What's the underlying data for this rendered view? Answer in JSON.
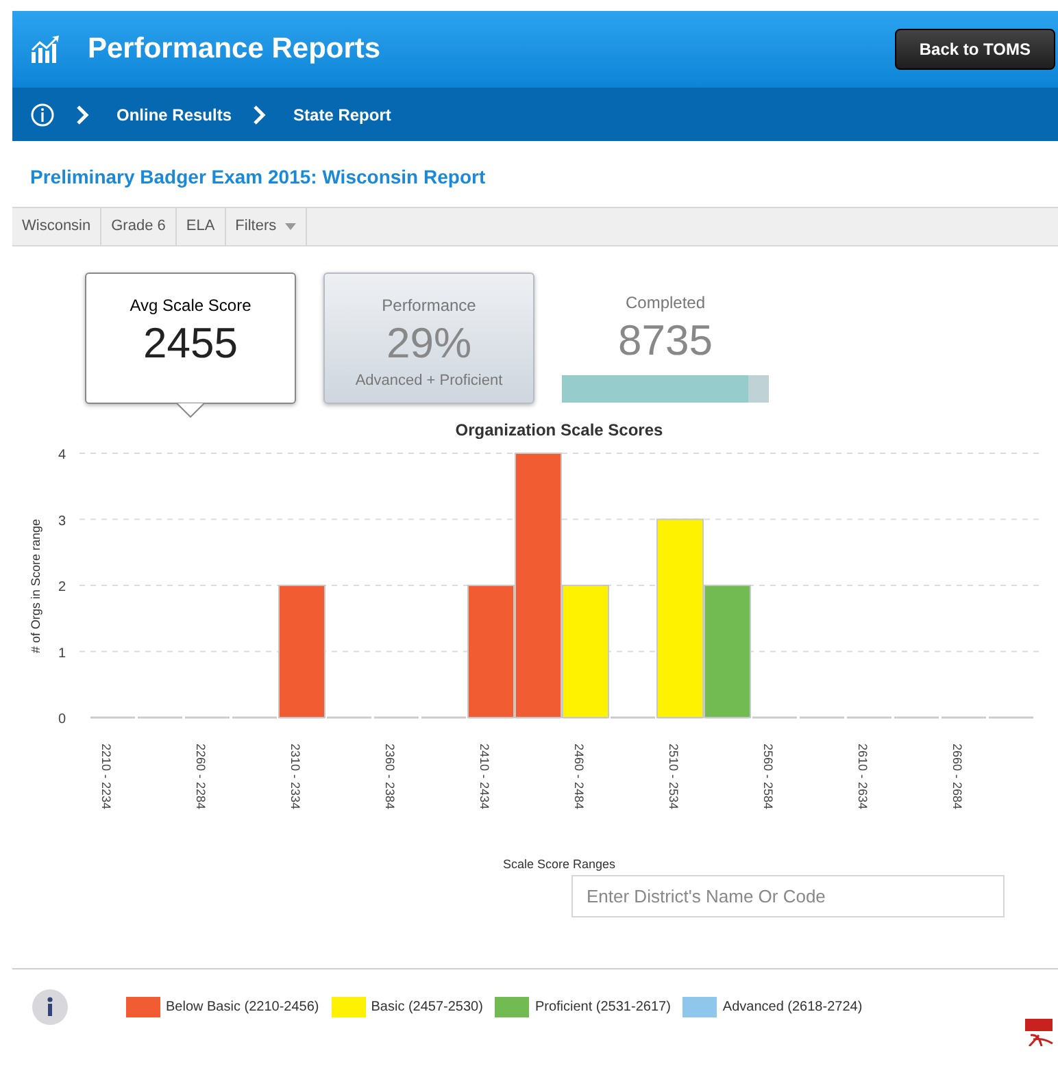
{
  "header": {
    "title": "Performance Reports",
    "back_button": "Back to TOMS"
  },
  "breadcrumbs": [
    "Online Results",
    "State Report"
  ],
  "report_title": "Preliminary Badger Exam 2015: Wisconsin Report",
  "filters": [
    {
      "label": "Wisconsin",
      "kind": "tag"
    },
    {
      "label": "Grade 6",
      "kind": "tag"
    },
    {
      "label": "ELA",
      "kind": "tag"
    },
    {
      "label": "Filters",
      "kind": "dropdown"
    }
  ],
  "cards": [
    {
      "kind": "stat",
      "selected": true,
      "label": "Avg Scale Score",
      "value": "2455"
    },
    {
      "kind": "stat",
      "selected": false,
      "label": "Performance",
      "value": "29%",
      "sublabel": "Advanced + Proficient"
    },
    {
      "kind": "progress",
      "label": "Completed",
      "value": "8735",
      "level": 0.9
    }
  ],
  "chart": {
    "chart_data": {
      "type": "bar",
      "title": "Organization Scale Scores",
      "xlabel": "Scale Score Ranges",
      "ylabel": "# of Orgs in Score range",
      "stacked": true,
      "grid": true,
      "categories": [
        "2210 - 2234",
        null,
        "2260 - 2284",
        null,
        "2310 - 2334",
        null,
        "2360 - 2384",
        null,
        "2410 - 2434",
        null,
        "2460 - 2484",
        null,
        "2510 - 2534",
        null,
        "2560 - 2584",
        null,
        "2610 - 2634",
        null,
        "2660 - 2684",
        null
      ],
      "yticks": [
        0,
        1,
        2,
        3,
        4
      ],
      "ylim": [
        0,
        4
      ],
      "series": [
        {
          "name": "Below Basic",
          "color": "#f25c33",
          "values": [
            0,
            0,
            0,
            0,
            2,
            0,
            0,
            0,
            2,
            4,
            0,
            0,
            0,
            0,
            0,
            0,
            0,
            0,
            0,
            0
          ]
        },
        {
          "name": "Basic",
          "color": "#fff200",
          "values": [
            0,
            0,
            0,
            0,
            0,
            0,
            0,
            0,
            0,
            0,
            2,
            0,
            3,
            0,
            0,
            0,
            0,
            0,
            0,
            0
          ]
        },
        {
          "name": "Proficient",
          "color": "#72bb53",
          "values": [
            0,
            0,
            0,
            0,
            0,
            0,
            0,
            0,
            0,
            0,
            0,
            0,
            0,
            2,
            0,
            0,
            0,
            0,
            0,
            0
          ]
        },
        {
          "name": "Advanced",
          "color": "#8fc6ec",
          "values": [
            0,
            0,
            0,
            0,
            0,
            0,
            0,
            0,
            0,
            0,
            0,
            0,
            0,
            0,
            0,
            0,
            0,
            0,
            0,
            0
          ]
        }
      ]
    }
  },
  "search": {
    "placeholder": "Enter District's Name Or Code"
  },
  "legend": [
    {
      "range": "(2210-2456)"
    },
    {
      "range": "(2457-2530)"
    },
    {
      "range": "(2531-2617)"
    },
    {
      "range": "(2618-2724)"
    }
  ]
}
